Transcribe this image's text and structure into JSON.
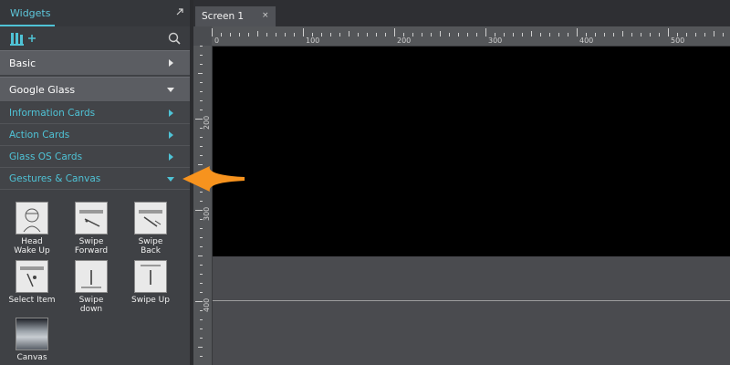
{
  "panel": {
    "title": "Widgets",
    "categories": [
      {
        "label": "Basic",
        "state": "collapsed"
      },
      {
        "label": "Google Glass",
        "state": "expanded"
      }
    ],
    "subcategories": [
      {
        "label": "Information Cards",
        "state": "collapsed"
      },
      {
        "label": "Action Cards",
        "state": "collapsed"
      },
      {
        "label": "Glass OS Cards",
        "state": "collapsed"
      },
      {
        "label": "Gestures & Canvas",
        "state": "expanded"
      }
    ],
    "widgets": [
      {
        "line1": "Head",
        "line2": "Wake Up"
      },
      {
        "line1": "Swipe",
        "line2": "Forward"
      },
      {
        "line1": "Swipe",
        "line2": "Back"
      },
      {
        "line1": "Select Item",
        "line2": ""
      },
      {
        "line1": "Swipe",
        "line2": "down"
      },
      {
        "line1": "Swipe Up",
        "line2": ""
      },
      {
        "line1": "Canvas",
        "line2": ""
      }
    ]
  },
  "editor": {
    "tab_label": "Screen 1",
    "tab_close": "×",
    "hruler_labels": [
      "0",
      "100",
      "200",
      "300",
      "400",
      "500"
    ],
    "vruler_labels": [
      "200",
      "300",
      "400"
    ]
  },
  "colors": {
    "accent": "#4fc3d6",
    "pointer": "#f7931e",
    "screen": "#000000"
  }
}
